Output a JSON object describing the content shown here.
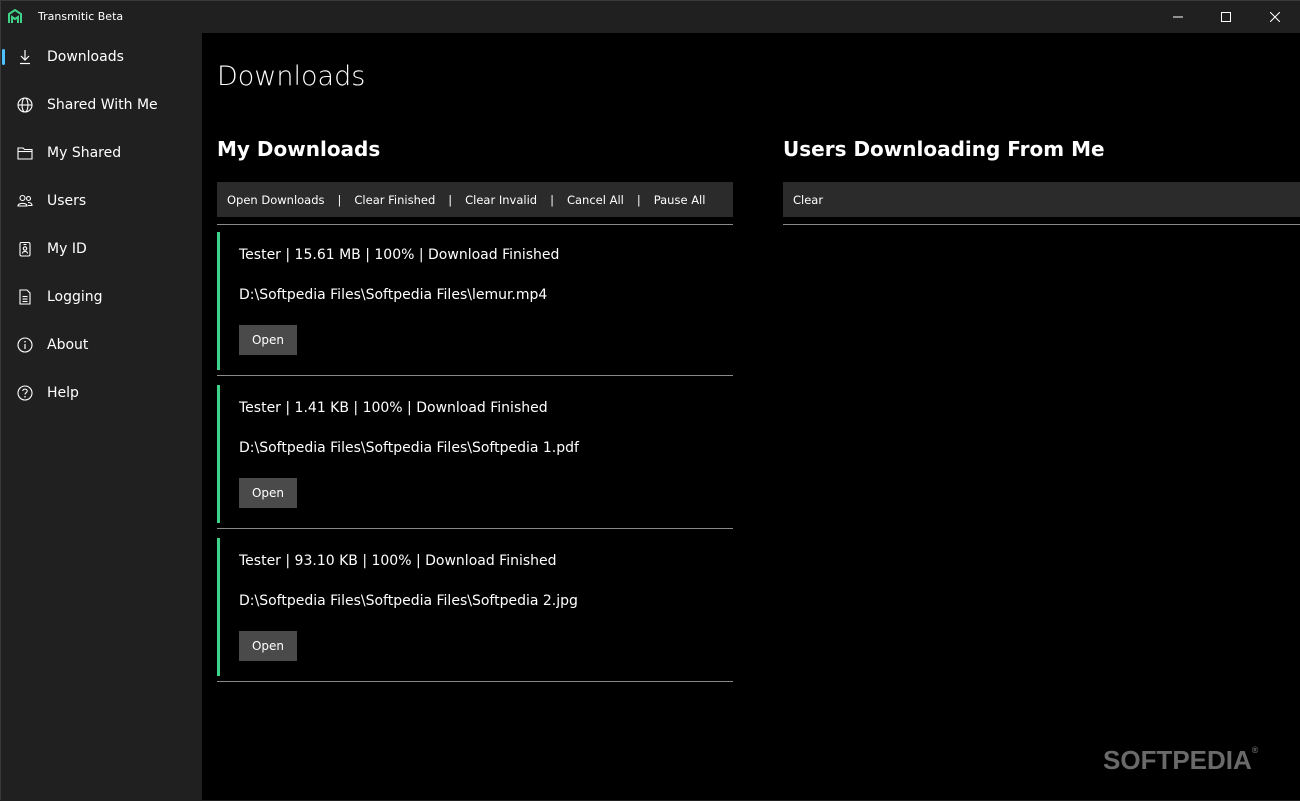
{
  "window": {
    "title": "Transmitic Beta",
    "accent_color": "#4cc2ff",
    "brand_color": "#3fd38a"
  },
  "sidebar": {
    "items": [
      {
        "label": "Downloads",
        "icon": "download-icon",
        "active": true
      },
      {
        "label": "Shared With Me",
        "icon": "globe-icon"
      },
      {
        "label": "My Shared",
        "icon": "folder-icon"
      },
      {
        "label": "Users",
        "icon": "users-icon"
      },
      {
        "label": "My ID",
        "icon": "id-badge-icon"
      },
      {
        "label": "Logging",
        "icon": "document-icon"
      },
      {
        "label": "About",
        "icon": "info-icon"
      },
      {
        "label": "Help",
        "icon": "help-icon"
      }
    ]
  },
  "main": {
    "page_title": "Downloads",
    "my_downloads": {
      "title": "My Downloads",
      "toolbar": [
        "Open Downloads",
        "Clear Finished",
        "Clear Invalid",
        "Cancel All",
        "Pause All"
      ],
      "separator": "|",
      "items": [
        {
          "info": "Tester | 15.61 MB | 100% | Download Finished",
          "path": "D:\\Softpedia Files\\Softpedia Files\\lemur.mp4",
          "button": "Open"
        },
        {
          "info": "Tester | 1.41 KB | 100% | Download Finished",
          "path": "D:\\Softpedia Files\\Softpedia Files\\Softpedia 1.pdf",
          "button": "Open"
        },
        {
          "info": "Tester | 93.10 KB | 100% | Download Finished",
          "path": "D:\\Softpedia Files\\Softpedia Files\\Softpedia 2.jpg",
          "button": "Open"
        }
      ]
    },
    "users_downloading": {
      "title": "Users Downloading From Me",
      "toolbar": [
        "Clear"
      ]
    }
  },
  "watermark": {
    "text": "SOFTPEDIA",
    "mark": "®"
  }
}
